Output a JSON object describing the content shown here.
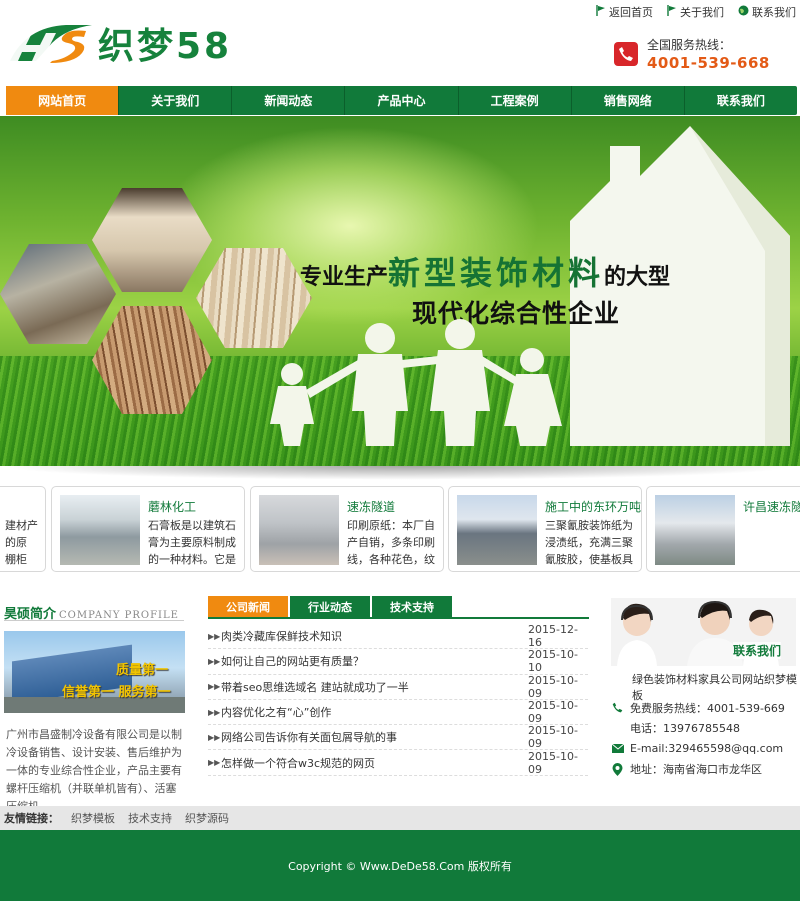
{
  "header": {
    "brand": "织梦58",
    "logo_initials": "HS",
    "top_links": [
      {
        "label": "返回首页",
        "icon": "flag-icon"
      },
      {
        "label": "关于我们",
        "icon": "flag-icon"
      },
      {
        "label": "联系我们",
        "icon": "globe-icon"
      }
    ],
    "hotline_label": "全国服务热线：",
    "hotline_number": "4001-539-668"
  },
  "nav": {
    "items": [
      "网站首页",
      "关于我们",
      "新闻动态",
      "产品中心",
      "工程案例",
      "销售网络",
      "联系我们"
    ],
    "active": 0
  },
  "banner": {
    "slogan_prefix": "专业生产",
    "slogan_highlight": "新型装饰材料",
    "slogan_suffix": "的大型",
    "slogan_line2": "现代化综合性企业"
  },
  "cases": [
    {
      "title": "",
      "desc": "建材产\n的原\n棚柜"
    },
    {
      "title": "蘑林化工",
      "desc": "石膏板是以建筑石膏为主要原料制成的一种材料。它是一"
    },
    {
      "title": "速冻隧道",
      "desc": "印刷原纸：本厂自产自销，多条印刷线，各种花色，纹理"
    },
    {
      "title": "施工中的东环万吨",
      "desc": "三聚氰胺装饰纸为浸渍纸，充满三聚氰胺胶，使基板具有"
    },
    {
      "title": "许昌速冻隧",
      "desc": ""
    }
  ],
  "about": {
    "title": "昊硕简介",
    "subtitle": "COMPANY PROFILE",
    "img_text_1": "质量第一",
    "img_text_2": "信誉第一 服务第一",
    "text": "广州市昌盛制冷设备有限公司是以制冷设备销售、设计安装、售后维护为一体的专业综合性企业，产品主要有螺杆压缩机（并联单机皆有）、活塞压缩机、..."
  },
  "news": {
    "tabs": [
      "公司新闻",
      "行业动态",
      "技术支持"
    ],
    "items": [
      {
        "title": "肉类冷藏库保鲜技术知识",
        "date": "2015-12-16"
      },
      {
        "title": "如何让自己的网站更有质量？",
        "date": "2015-10-10"
      },
      {
        "title": "带着seo思维选域名 建站就成功了一半",
        "date": "2015-10-09"
      },
      {
        "title": "内容优化之有“心”创作",
        "date": "2015-10-09"
      },
      {
        "title": "网络公司告诉你有关面包屑导航的事",
        "date": "2015-10-09"
      },
      {
        "title": "怎样做一个符合w3c规范的网页",
        "date": "2015-10-09"
      }
    ]
  },
  "contact": {
    "label": "联系我们",
    "company": "绿色装饰材料家具公司网站织梦模板",
    "hotline": "免费服务热线：4001-539-669",
    "phone": "电话：13976785548",
    "email": "E-mail:329465598@qq.com",
    "address": "地址：海南省海口市龙华区"
  },
  "friends": {
    "label": "友情链接：",
    "links": [
      "织梦模板",
      "技术支持",
      "织梦源码"
    ]
  },
  "footer": {
    "copyright": "Copyright © Www.DeDe58.Com 版权所有"
  },
  "colors": {
    "primary": "#117a3a",
    "accent": "#f08a10",
    "hotline": "#e35a16"
  }
}
